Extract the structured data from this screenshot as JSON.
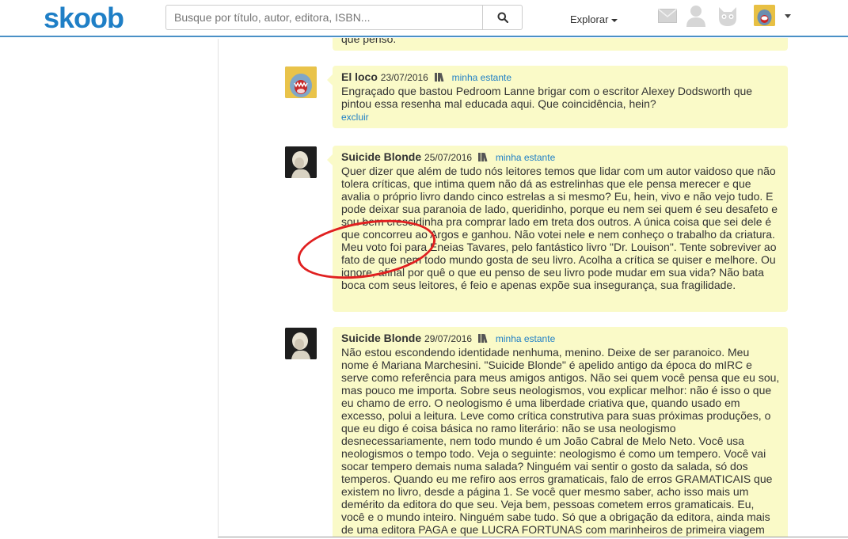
{
  "header": {
    "logo": "skoob",
    "search_placeholder": "Busque por título, autor, editora, ISBN...",
    "explore_label": "Explorar",
    "icons": [
      "search-icon",
      "envelope-icon",
      "user-icon",
      "cat-icon",
      "avatar"
    ]
  },
  "top_fragment": "que penso.",
  "comments": [
    {
      "author": "El loco",
      "date": "23/07/2016",
      "shelf_label": "minha estante",
      "text": "Engraçado que bastou Pedroom Lanne brigar com o escritor Alexey Dodsworth que pintou essa resenha mal educada aqui. Que coincidência, hein?",
      "delete_label": "excluir"
    },
    {
      "author": "Suicide Blonde",
      "date": "25/07/2016",
      "shelf_label": "minha estante",
      "text": "Quer dizer que além de tudo nós leitores temos que lidar com um autor vaidoso que não tolera críticas, que intima quem não dá as estrelinhas que ele pensa merecer e que avalia o próprio livro dando cinco estrelas a si mesmo? Eu, hein, vivo e não vejo tudo. E pode deixar sua paranoia de lado, queridinho, porque eu nem sei quem é seu desafeto e sou bem crescidinha pra comprar lado em treta dos outros. A única coisa que sei dele é que concorreu ao Argos e ganhou. Não votei nele e nem conheço o trabalho da criatura. Meu voto foi para Eneias Tavares, pelo fantástico livro \"Dr. Louison\". Tente sobreviver ao fato de que nem todo mundo gosta de seu livro. Acolha a crítica se quiser e melhore. Ou ignore, afinal por quê o que eu penso de seu livro pode mudar em sua vida? Não bata boca com seus leitores, é feio e apenas expõe sua insegurança, sua fragilidade."
    },
    {
      "author": "Suicide Blonde",
      "date": "29/07/2016",
      "shelf_label": "minha estante",
      "text": "Não estou escondendo identidade nenhuma, menino. Deixe de ser paranoico. Meu nome é Mariana Marchesini. \"Suicide Blonde\" é apelido antigo da época do mIRC e serve como referência para meus amigos antigos. Não sei quem você pensa que eu sou, mas pouco me importa. Sobre seus neologismos, vou explicar melhor: não é isso o que eu chamo de erro. O neologismo é uma liberdade criativa que, quando usado em excesso, polui a leitura. Leve como crítica construtiva para suas próximas produções, o que eu digo é coisa básica no ramo literário: não se usa neologismo desnecessariamente, nem todo mundo é um João Cabral de Melo Neto. Você usa neologismos o tempo todo. Veja o seguinte: neologismo é como um tempero. Você vai socar tempero demais numa salada? Ninguém vai sentir o gosto da salada, só dos temperos. Quando eu me refiro aos erros gramaticais, falo de erros GRAMATICAIS que existem no livro, desde a página 1. Se você quer mesmo saber, acho isso mais um demérito da editora do que seu. Veja bem, pessoas cometem erros gramaticais. Eu, você e o mundo inteiro. Ninguém sabe tudo. Só que a obrigação da editora, ainda mais de uma editora PAGA e que LUCRA FORTUNAS com marinheiros de primeira viagem"
    }
  ],
  "colors": {
    "brand": "#1f7fc6",
    "bubble": "#fafac8",
    "annotation": "#e02020"
  }
}
